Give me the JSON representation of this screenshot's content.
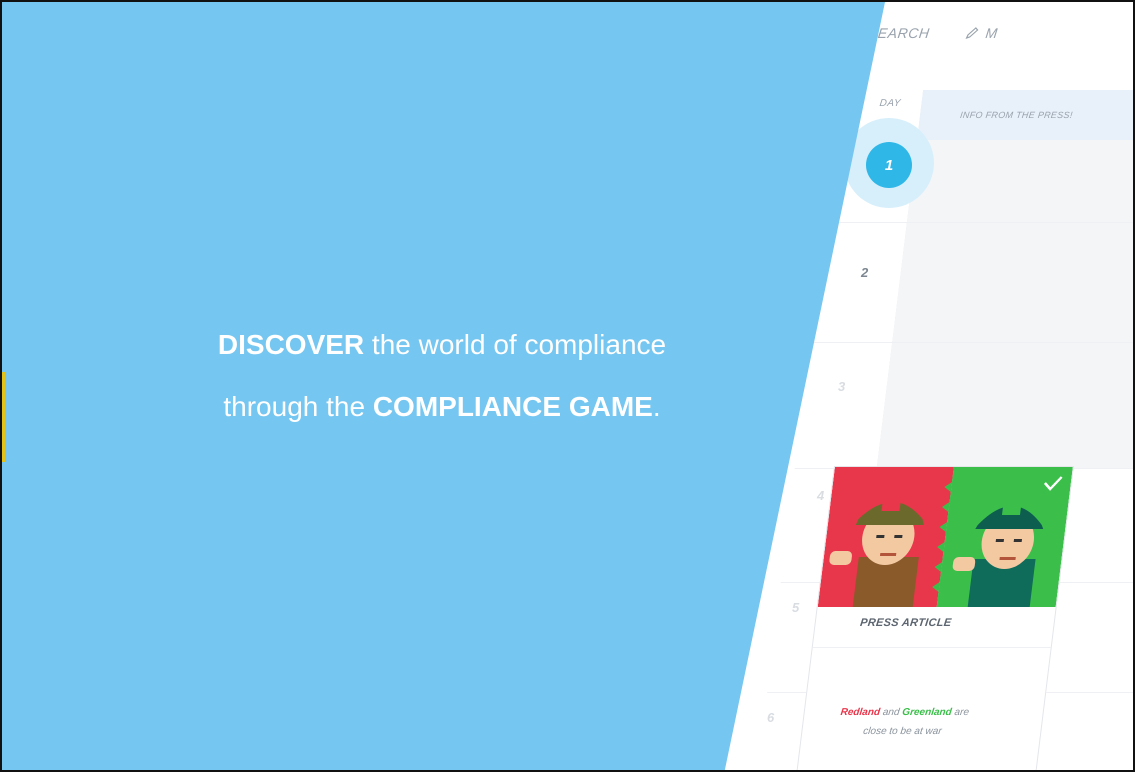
{
  "topbar": {
    "search_label": "SEARCH",
    "second_label": "M"
  },
  "table": {
    "day_header": "DAY",
    "press_header": "INFO FROM THE PRESS!",
    "days": [
      "1",
      "2",
      "3",
      "4",
      "5",
      "6"
    ],
    "current_day": "1"
  },
  "headline": {
    "line1_bold": "DISCOVER",
    "line1_rest": " the world of compliance",
    "line2_start": "through the ",
    "line2_bold": "COMPLIANCE GAME",
    "line2_end": "."
  },
  "card": {
    "title": "PRESS ARTICLE",
    "text_red": "Redland",
    "text_and": " and ",
    "text_green": "Greenland",
    "text_rest": " are",
    "text_line2": "close to be at war",
    "checked": true
  },
  "colors": {
    "blue_bg": "#75c6f0",
    "accent_blue": "#2fb7e8",
    "red": "#e8364b",
    "green": "#3bbf4a"
  }
}
